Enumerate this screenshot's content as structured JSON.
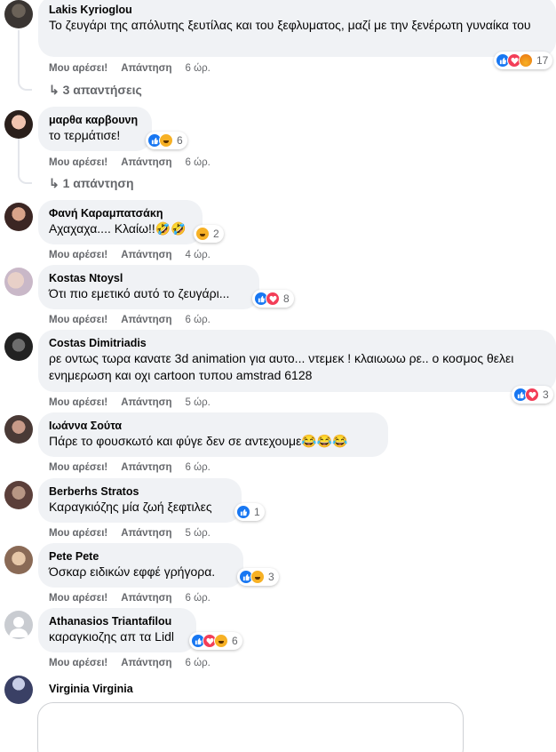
{
  "colors": {
    "like": "#1877f2",
    "love": "#f33e58",
    "haha": "#f7b125",
    "angry": "#e9710f",
    "meta": "#65676b",
    "bubble": "#f0f2f5"
  },
  "actions": {
    "like": "Μου αρέσει!",
    "reply": "Απάντηση"
  },
  "comments": [
    {
      "author": "Lakis Kyrioglou",
      "text": "Το ζευγάρι της απόλυτης ξευτίλας και του ξεφλυματος, μαζί με την ξενέρωτη γυναίκα του",
      "time": "6 ώρ.",
      "reactions": [
        "like",
        "love",
        "angry"
      ],
      "count": "17",
      "replies": "3 απαντήσεις"
    },
    {
      "author": "μαρθα καρβουνη",
      "text": "το τερμάτισε!",
      "time": "6 ώρ.",
      "reactions": [
        "like",
        "haha"
      ],
      "count": "6",
      "replies": "1 απάντηση"
    },
    {
      "author": "Φανή Καραμπατσάκη",
      "text": "Αχαχαχα.... Κλαίω!!🤣🤣",
      "time": "4 ώρ.",
      "reactions": [
        "haha"
      ],
      "count": "2"
    },
    {
      "author": "Kostas Ntoysl",
      "text": "Ότι πιο εμετικό αυτό το ζευγάρι...",
      "time": "6 ώρ.",
      "reactions": [
        "like",
        "love"
      ],
      "count": "8"
    },
    {
      "author": "Costas Dimitriadis",
      "text": "ρε οντως τωρα κανατε 3d animation για αυτο... ντεμεκ ! κλαιωωω ρε.. ο κοσμος θελει ενημερωση και οχι cartoon τυπου amstrad 6128",
      "time": "5 ώρ.",
      "reactions": [
        "like",
        "love"
      ],
      "count": "3"
    },
    {
      "author": "Ιωάννα Σούτα",
      "text": "Πάρε το φουσκωτό και φύγε δεν σε αντεχουμε😂😂😂",
      "time": "6 ώρ."
    },
    {
      "author": "Berberhs Stratos",
      "text": "Καραγκιόζης μία ζωή ξεφτιλες",
      "time": "5 ώρ.",
      "reactions": [
        "like"
      ],
      "count": "1"
    },
    {
      "author": "Pete Pete",
      "text": "Όσκαρ ειδικών εφφέ γρήγορα.",
      "time": "6 ώρ.",
      "reactions": [
        "like",
        "haha"
      ],
      "count": "3"
    },
    {
      "author": "Athanasios Triantafilou",
      "text": "καραγκιοζης απ τα Lidl",
      "time": "6 ώρ.",
      "reactions": [
        "like",
        "love",
        "haha"
      ],
      "count": "6"
    }
  ],
  "composer": {
    "author": "Virginia Virginia"
  }
}
